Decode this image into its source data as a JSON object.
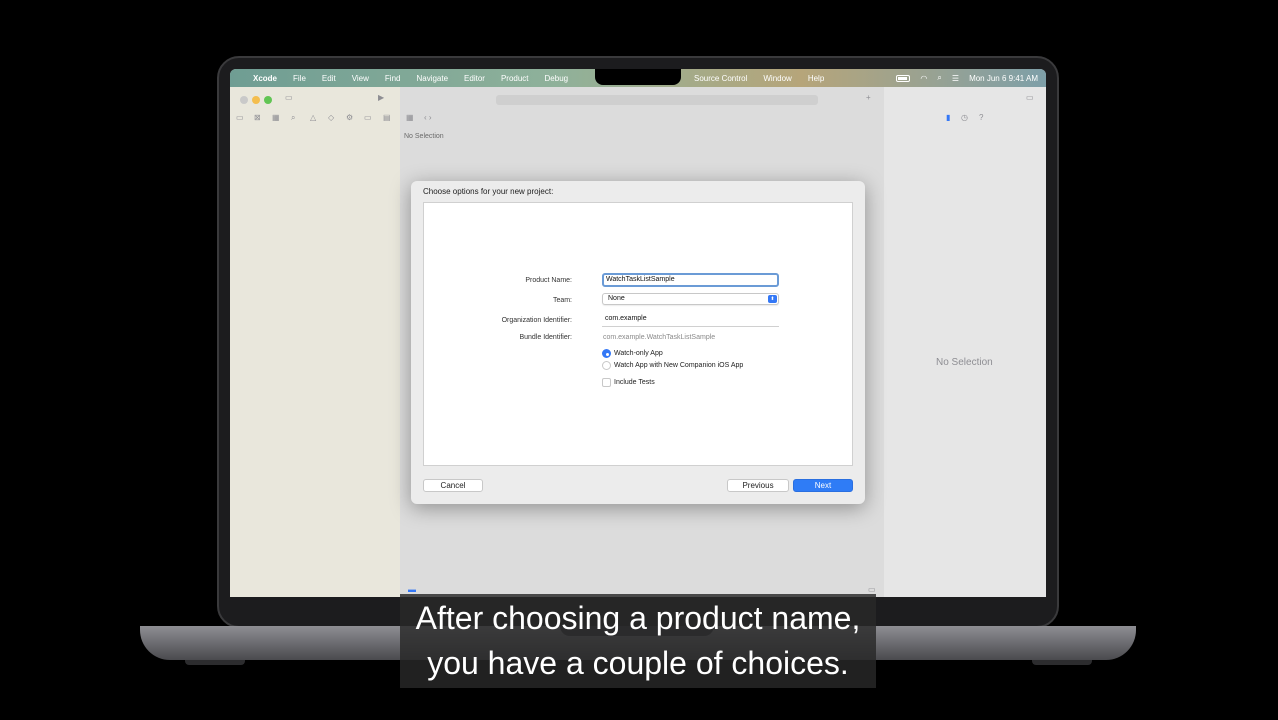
{
  "menubar": {
    "app": "Xcode",
    "items": [
      "File",
      "Edit",
      "View",
      "Find",
      "Navigate",
      "Editor",
      "Product",
      "Debug"
    ],
    "items_right": [
      "Source Control",
      "Window",
      "Help"
    ],
    "clock": "Mon Jun 6  9:41 AM"
  },
  "xcode": {
    "editor_no_selection": "No Selection",
    "inspector_no_selection": "No Selection"
  },
  "dialog": {
    "title": "Choose options for your new project:",
    "product_name_label": "Product Name:",
    "product_name_value": "WatchTaskListSample",
    "team_label": "Team:",
    "team_value": "None",
    "org_id_label": "Organization Identifier:",
    "org_id_value": "com.example",
    "bundle_id_label": "Bundle Identifier:",
    "bundle_id_value": "com.example.WatchTaskListSample",
    "option_watch_only": "Watch-only App",
    "option_watch_ios": "Watch App with New Companion iOS App",
    "include_tests": "Include Tests",
    "cancel": "Cancel",
    "previous": "Previous",
    "next": "Next"
  },
  "caption": {
    "line1": "After choosing a product name,",
    "line2": "you have a couple of choices."
  },
  "colors": {
    "accent": "#2f7cf6",
    "caption_bg": "#282828"
  }
}
